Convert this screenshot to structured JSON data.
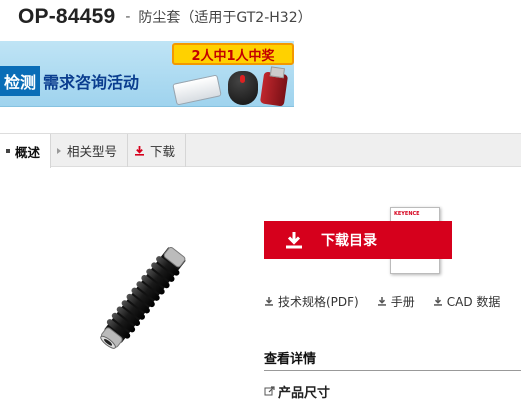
{
  "header": {
    "model": "OP-84459",
    "separator": "-",
    "subtitle": "防尘套（适用于GT2-H32）"
  },
  "banner": {
    "tag": "2人中1人中奖",
    "title_highlight": "检测",
    "title_rest": "需求咨询活动"
  },
  "tabs": [
    {
      "label": "概述",
      "active": true
    },
    {
      "label": "相关型号",
      "active": false
    },
    {
      "label": "下载",
      "active": false
    }
  ],
  "download": {
    "button_label": "下载目录",
    "catalog_logo": "KEYENCE",
    "catalog_text": "产品概览"
  },
  "links": [
    {
      "label": "技术规格(PDF)"
    },
    {
      "label": "手册"
    },
    {
      "label": "CAD 数据"
    }
  ],
  "details": {
    "title": "查看详情",
    "link": "产品尺寸"
  },
  "colors": {
    "accent_red": "#d6001c",
    "banner_blue": "#0a6db7",
    "tab_bg": "#efefef"
  }
}
